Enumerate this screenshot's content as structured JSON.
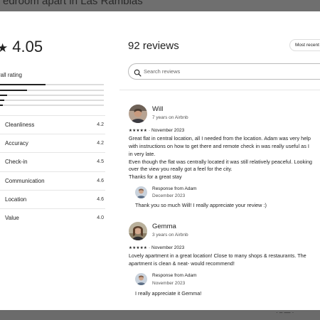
{
  "backdrop": {
    "listing_title": "edroom apart in Las Ramblas",
    "bottom_snippet": "· – –– ·"
  },
  "summary": {
    "star_glyph": "★",
    "overall_value": "4.05",
    "overall_label": "rall rating",
    "distribution": [
      0.44,
      0.26,
      0.07,
      0.04,
      0.03
    ],
    "categories": [
      {
        "label": "Cleanliness",
        "value": "4.2"
      },
      {
        "label": "Accuracy",
        "value": "4.2"
      },
      {
        "label": "Check-in",
        "value": "4.5"
      },
      {
        "label": "Communication",
        "value": "4.6"
      },
      {
        "label": "Location",
        "value": "4.6"
      },
      {
        "label": "Value",
        "value": "4.0"
      }
    ]
  },
  "reviews_header": {
    "title": "92 reviews",
    "sort_label": "Most recent"
  },
  "search": {
    "placeholder": "Search reviews",
    "value": ""
  },
  "reviews": [
    {
      "name": "Will",
      "subtitle": "7 years on Airbnb",
      "stars": "★★★★★",
      "date": "· November 2023",
      "text": [
        "Great flat in central location, all I needed from the location. Adam was very help",
        "with instructions on how to get there and remote check in was really useful as I",
        "in very late.",
        "Even though the flat was centrally located it was still relatively peaceful. Looking",
        "over the view you really got a feel for the city.",
        "Thanks for a great stay"
      ],
      "response": {
        "from": "Response from Adam",
        "date": "December 2023",
        "text": "Thank you so much Will! I really appreciate your review :)"
      }
    },
    {
      "name": "Gemma",
      "subtitle": "3 years on Airbnb",
      "stars": "★★★★★",
      "date": "· November 2023",
      "text": [
        "Lovely apartment in a great location! Close to many shops & restaurants. The",
        "apartment is clean & neat- would recommend!"
      ],
      "response": {
        "from": "Response from Adam",
        "date": "November 2023",
        "text": "I really appreciate it Gemma!"
      }
    }
  ],
  "colors": {
    "overlay": "#6f6f6f",
    "text": "#222222",
    "divider": "#e6e6e6"
  }
}
